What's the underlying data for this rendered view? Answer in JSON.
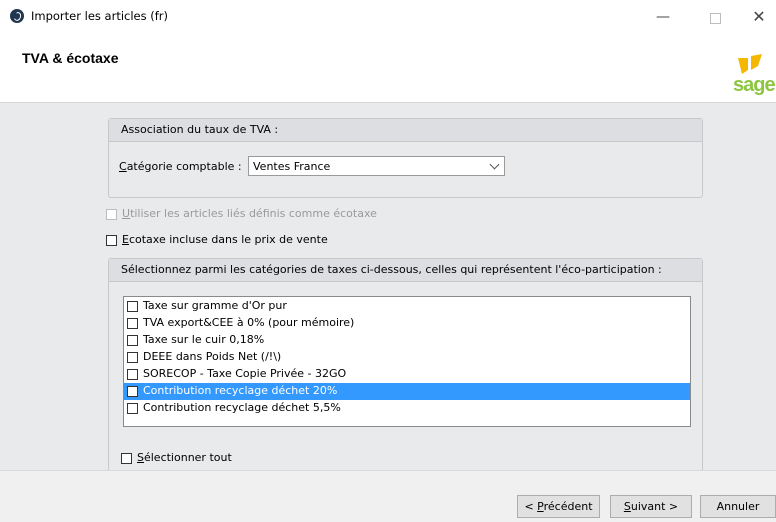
{
  "window": {
    "title": "Importer les articles (fr)",
    "controls": {
      "minimize": "—",
      "close": "✕"
    }
  },
  "header": {
    "title": "TVA & écotaxe",
    "logo_text": "sage"
  },
  "tva_group": {
    "header": "Association du taux de TVA :",
    "category_label_accel": "C",
    "category_label_rest": "atégorie comptable :",
    "category_value": "Ventes France"
  },
  "options": {
    "linked_articles_accel": "U",
    "linked_articles_rest": "tiliser les articles liés définis comme écotaxe",
    "linked_articles_enabled": false,
    "included_in_price_accel": "E",
    "included_in_price_rest": "cotaxe incluse dans le prix de vente"
  },
  "eco_group": {
    "header": "Sélectionnez parmi les catégories de taxes ci-dessous, celles qui représentent l'éco-participation :",
    "items": [
      {
        "label": "Taxe sur gramme d'Or pur",
        "selected": false
      },
      {
        "label": "TVA export&CEE à 0% (pour mémoire)",
        "selected": false
      },
      {
        "label": "Taxe sur le cuir 0,18%",
        "selected": false
      },
      {
        "label": "DEEE dans Poids Net (/!\\)",
        "selected": false
      },
      {
        "label": "SORECOP - Taxe Copie Privée - 32GO",
        "selected": false
      },
      {
        "label": "Contribution recyclage déchet 20%",
        "selected": true
      },
      {
        "label": "Contribution recyclage déchet 5,5%",
        "selected": false
      }
    ],
    "select_all_accel": "S",
    "select_all_rest": "électionner tout"
  },
  "footer": {
    "prev_prefix": "< ",
    "prev_accel": "P",
    "prev_rest": "récédent",
    "next_accel": "S",
    "next_rest": "uivant >",
    "cancel": "Annuler"
  },
  "colors": {
    "selection": "#3399ff",
    "content_bg": "#e9eaeb",
    "logo_green": "#8cc63f",
    "logo_yellow": "#f5b800"
  }
}
